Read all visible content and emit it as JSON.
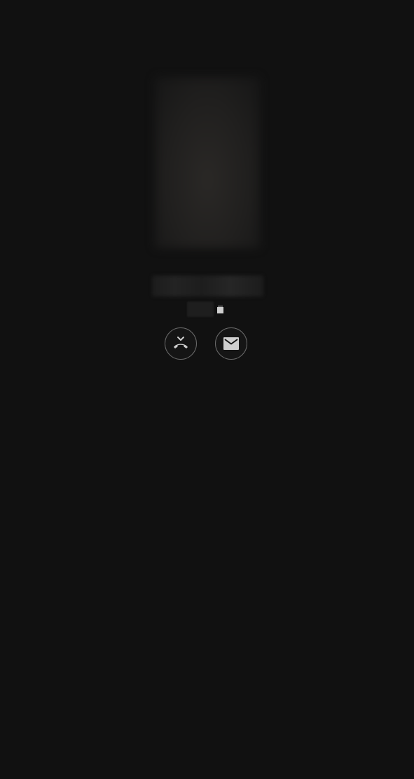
{
  "call": {
    "caller_name": "",
    "caller_number": ""
  },
  "actions": {
    "reject": {
      "icon": "decline-call-icon"
    },
    "message": {
      "icon": "envelope-icon"
    }
  },
  "icons": {
    "sim": "sim-card-icon"
  },
  "colors": {
    "background": "#111111",
    "icon": "#cfcfcf",
    "button_border": "#6a6a6a"
  }
}
